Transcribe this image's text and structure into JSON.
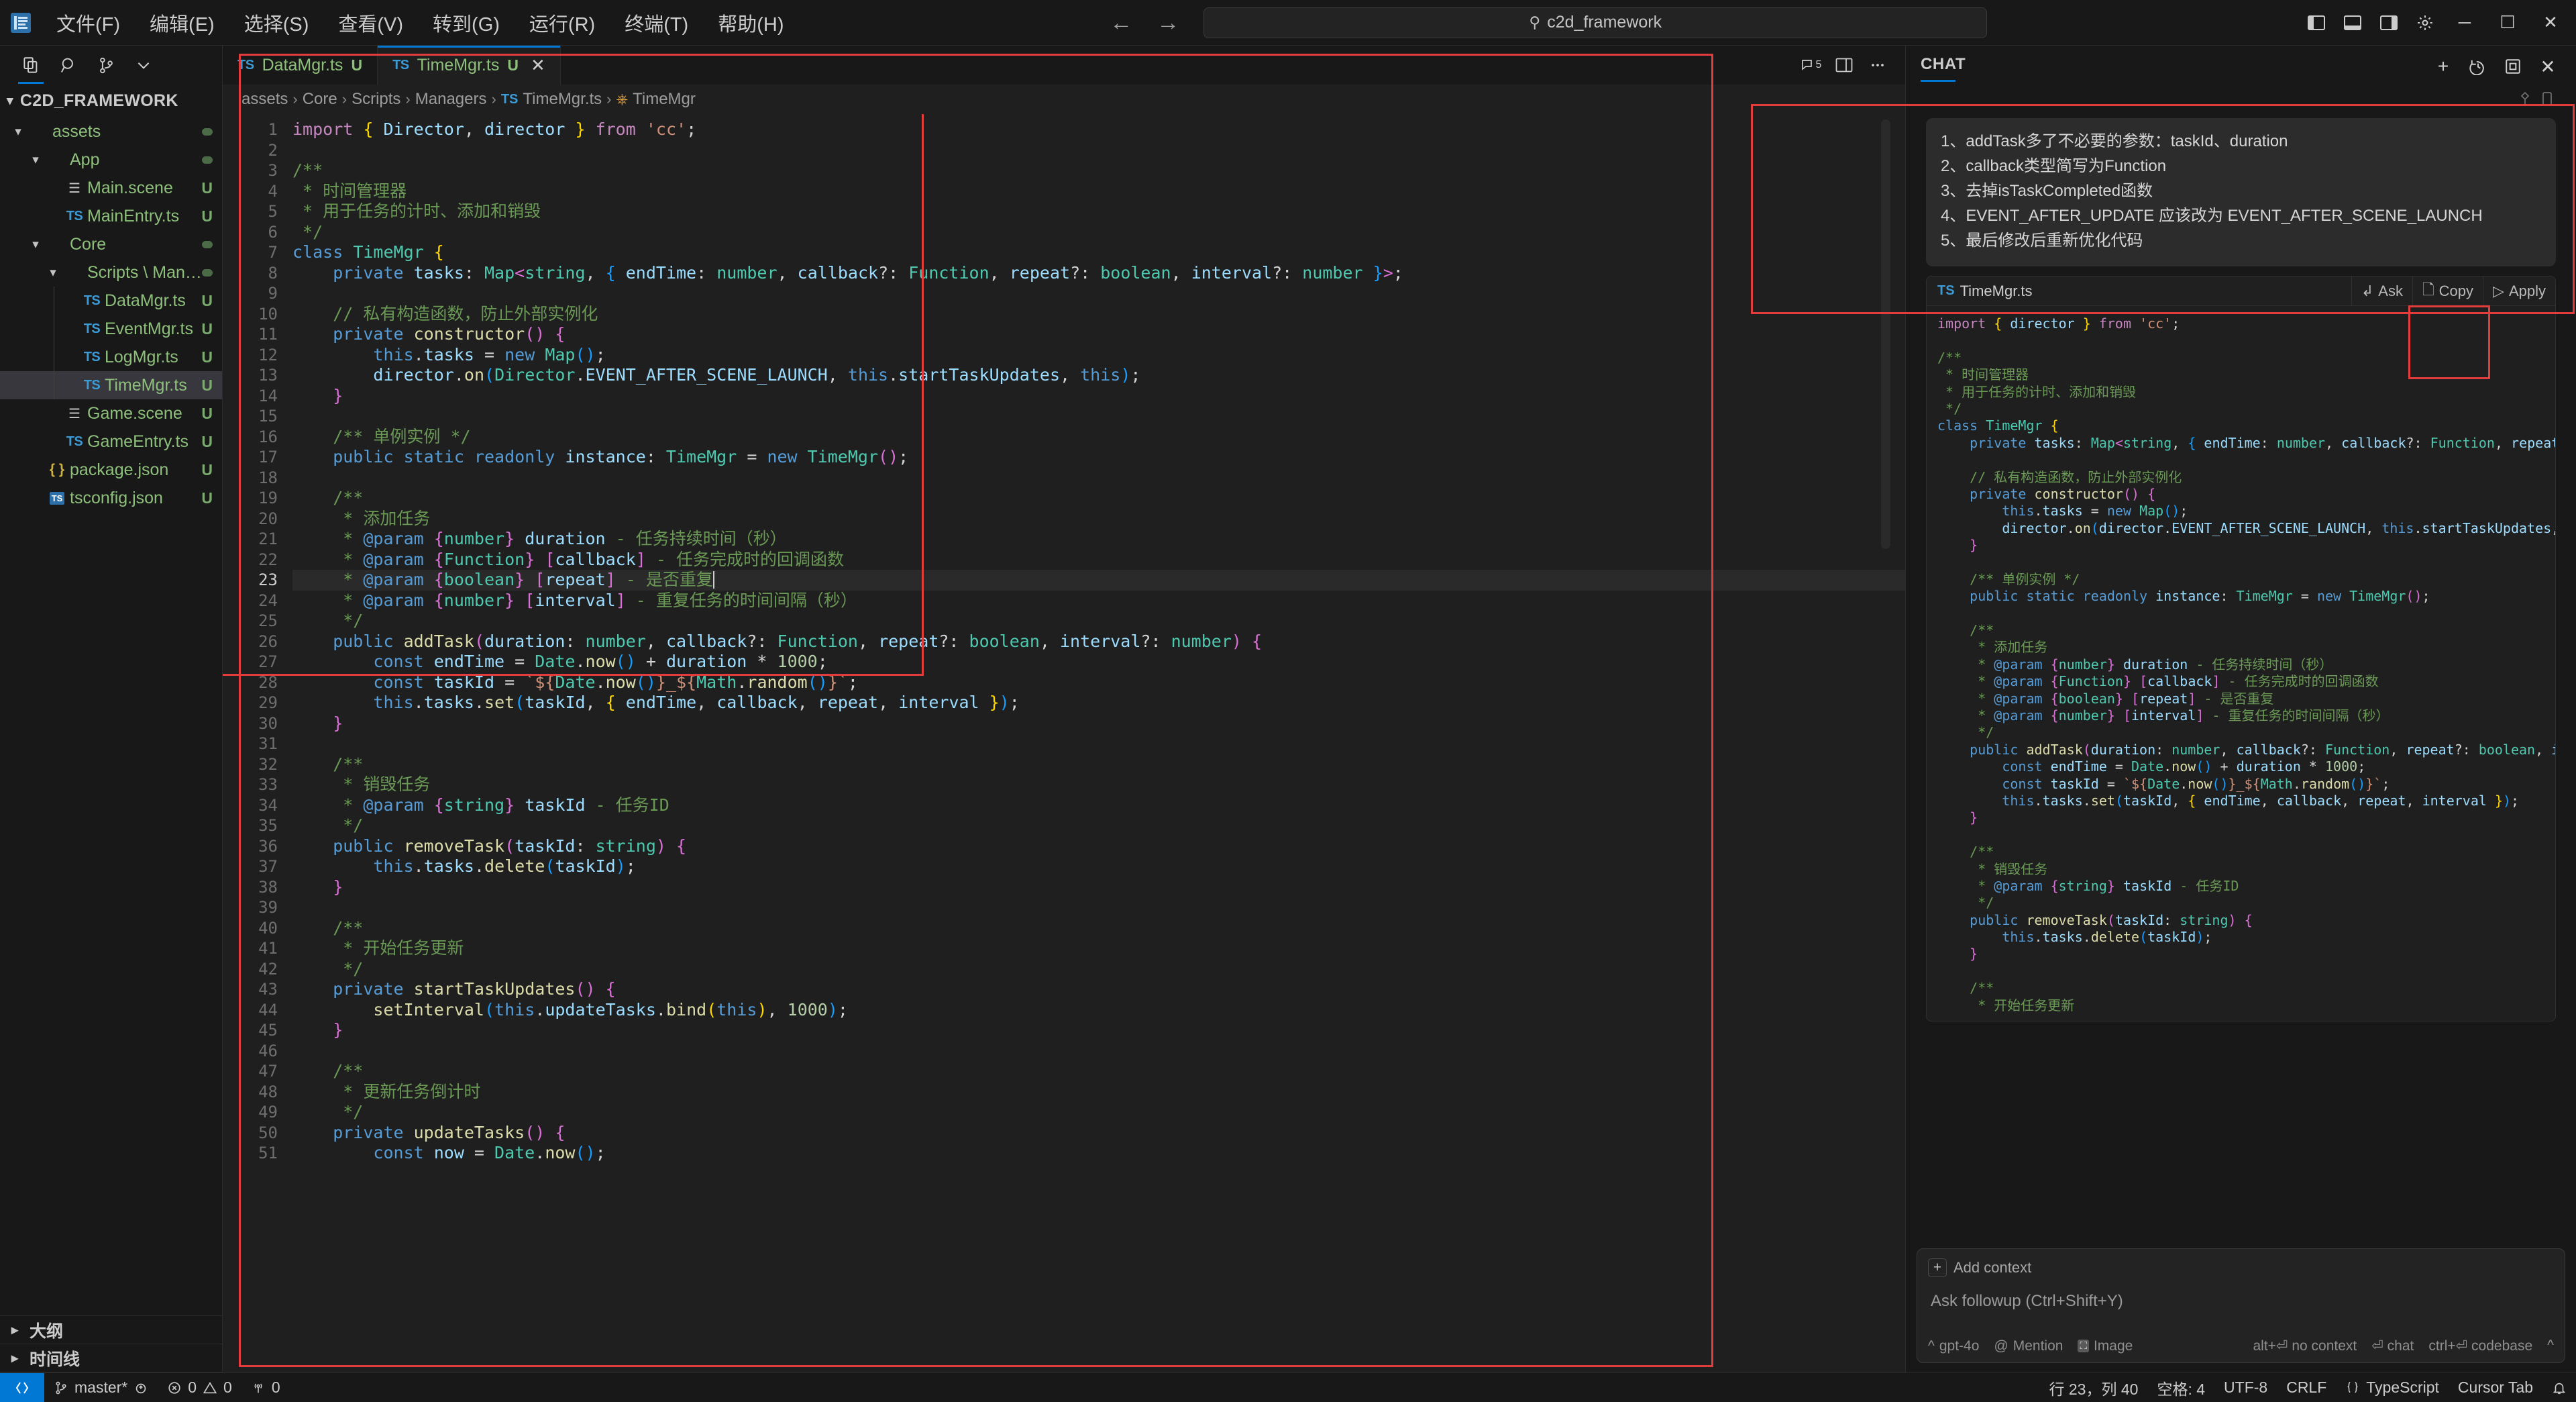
{
  "titlebar": {
    "menus": [
      "文件(F)",
      "编辑(E)",
      "选择(S)",
      "查看(V)",
      "转到(G)",
      "运行(R)",
      "终端(T)",
      "帮助(H)"
    ],
    "search_text": "c2d_framework",
    "back_icon": "arrow-left-icon",
    "forward_icon": "arrow-right-icon",
    "right_icons": [
      "toggle-primary-sidebar-icon",
      "toggle-panel-icon",
      "toggle-secondary-sidebar-icon",
      "settings-gear-icon"
    ],
    "window_minimize": "─",
    "window_maximize": "☐",
    "window_close": "✕"
  },
  "sidebar": {
    "tools": [
      "explorer-icon",
      "search-icon",
      "source-control-icon",
      "chevron-down-icon"
    ],
    "explorer_title": "C2D_FRAMEWORK",
    "tree": [
      {
        "label": "assets",
        "depth": 0,
        "kind": "folder",
        "chev": "⌄",
        "badge": "",
        "dot": true,
        "selected": false
      },
      {
        "label": "App",
        "depth": 1,
        "kind": "folder",
        "chev": "⌄",
        "badge": "",
        "dot": true,
        "selected": false
      },
      {
        "label": "Main.scene",
        "depth": 2,
        "kind": "scene",
        "chev": "",
        "badge": "U",
        "dot": false,
        "selected": false
      },
      {
        "label": "MainEntry.ts",
        "depth": 2,
        "kind": "ts",
        "chev": "",
        "badge": "U",
        "dot": false,
        "selected": false
      },
      {
        "label": "Core",
        "depth": 1,
        "kind": "folder",
        "chev": "⌄",
        "badge": "",
        "dot": true,
        "selected": false
      },
      {
        "label": "Scripts \\ Man…",
        "depth": 2,
        "kind": "folder",
        "chev": "⌄",
        "badge": "",
        "dot": true,
        "selected": false
      },
      {
        "label": "DataMgr.ts",
        "depth": 3,
        "kind": "ts",
        "chev": "",
        "badge": "U",
        "dot": false,
        "selected": false
      },
      {
        "label": "EventMgr.ts",
        "depth": 3,
        "kind": "ts",
        "chev": "",
        "badge": "U",
        "dot": false,
        "selected": false
      },
      {
        "label": "LogMgr.ts",
        "depth": 3,
        "kind": "ts",
        "chev": "",
        "badge": "U",
        "dot": false,
        "selected": false
      },
      {
        "label": "TimeMgr.ts",
        "depth": 3,
        "kind": "ts",
        "chev": "",
        "badge": "U",
        "dot": false,
        "selected": true
      },
      {
        "label": "Game.scene",
        "depth": 2,
        "kind": "scene",
        "chev": "",
        "badge": "U",
        "dot": false,
        "selected": false
      },
      {
        "label": "GameEntry.ts",
        "depth": 2,
        "kind": "ts",
        "chev": "",
        "badge": "U",
        "dot": false,
        "selected": false
      },
      {
        "label": "package.json",
        "depth": 1,
        "kind": "json",
        "chev": "",
        "badge": "U",
        "dot": false,
        "selected": false
      },
      {
        "label": "tsconfig.json",
        "depth": 1,
        "kind": "tsconf",
        "chev": "",
        "badge": "U",
        "dot": false,
        "selected": false
      }
    ],
    "sections": [
      "大纲",
      "时间线"
    ]
  },
  "editor": {
    "tabs": [
      {
        "ts": "TS",
        "name": "DataMgr.ts",
        "mod": "U",
        "active": false,
        "close": ""
      },
      {
        "ts": "TS",
        "name": "TimeMgr.ts",
        "mod": "U",
        "active": true,
        "close": "✕"
      }
    ],
    "tab_actions": [
      "split-editor-icon",
      "more-actions-icon"
    ],
    "chat_count": "5",
    "breadcrumb": [
      "assets",
      "Core",
      "Scripts",
      "Managers",
      "TimeMgr.ts",
      "TimeMgr"
    ],
    "first_line": 1,
    "last_line": 50,
    "cursor_line": 23
  },
  "chat": {
    "title": "CHAT",
    "head_actions": [
      "new-chat-icon",
      "history-icon",
      "maximize-chat-icon",
      "close-chat-icon"
    ],
    "message_lines": [
      "1、addTask多了不必要的参数：taskId、duration",
      "2、callback类型简写为Function",
      "3、去掉isTaskCompleted函数",
      "4、EVENT_AFTER_UPDATE 应该改为 EVENT_AFTER_SCENE_LAUNCH",
      "5、最后修改后重新优化代码"
    ],
    "codeblock": {
      "ts": "TS",
      "filename": "TimeMgr.ts",
      "ask_label": "Ask",
      "copy_label": "Copy",
      "apply_label": "Apply"
    },
    "input": {
      "add_context": "Add context",
      "placeholder": "Ask followup (Ctrl+Shift+Y)",
      "model": "gpt-4o",
      "mention": "Mention",
      "image": "Image",
      "hint_no_context": "alt+⏎ no context",
      "hint_chat": "⏎ chat",
      "hint_codebase": "ctrl+⏎ codebase"
    }
  },
  "statusbar": {
    "remote_icon": "remote-window-icon",
    "branch": "master*",
    "sync_icon": "sync-icon",
    "errors": "0",
    "warnings": "0",
    "ports": "0",
    "position": "行 23，列 40",
    "spaces": "空格: 4",
    "encoding": "UTF-8",
    "eol": "CRLF",
    "language": "TypeScript",
    "cursor_tab": "Cursor Tab",
    "bell_icon": "bell-icon"
  },
  "colors": {
    "accent": "#0078d4",
    "modified_green": "#8ec07c",
    "red_annotation": "#e33c3c",
    "bg_dark": "#181818",
    "bg_editor": "#1f1f1f"
  }
}
